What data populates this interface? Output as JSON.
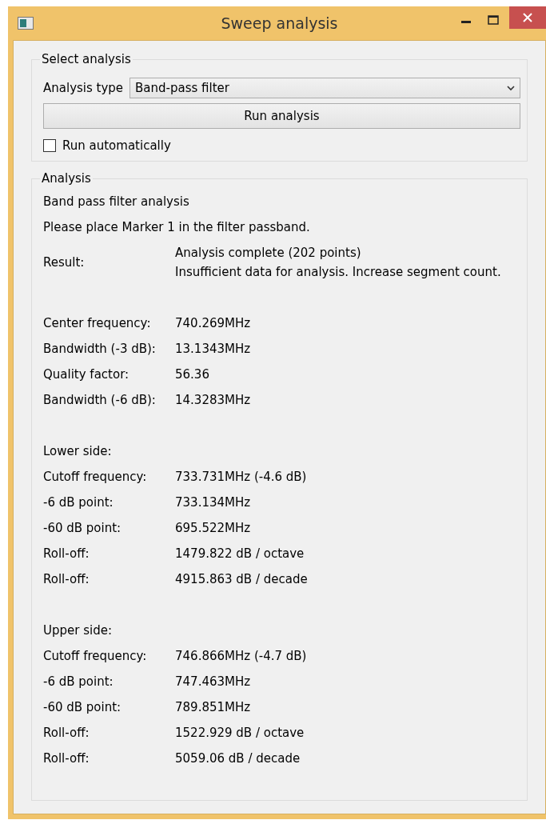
{
  "window": {
    "title": "Sweep analysis"
  },
  "select_analysis": {
    "title": "Select analysis",
    "analysis_type": {
      "label": "Analysis type",
      "value": "Band-pass filter"
    },
    "run_button": "Run analysis",
    "run_automatically": {
      "label": "Run automatically",
      "checked": false
    }
  },
  "analysis": {
    "title": "Analysis",
    "lines": [
      "Band pass filter analysis",
      "Please place Marker 1 in the filter passband."
    ],
    "result": {
      "label": "Result:",
      "value_lines": [
        "Analysis complete (202 points)",
        "Insufficient data for analysis. Increase segment count."
      ]
    },
    "groups": [
      {
        "rows": [
          {
            "label": "Center frequency:",
            "value": "740.269MHz"
          },
          {
            "label": "Bandwidth (-3 dB):",
            "value": "13.1343MHz"
          },
          {
            "label": "Quality factor:",
            "value": "56.36"
          },
          {
            "label": "Bandwidth (-6 dB):",
            "value": "14.3283MHz"
          }
        ]
      },
      {
        "heading": "Lower side:",
        "rows": [
          {
            "label": "Cutoff frequency:",
            "value": "733.731MHz (-4.6 dB)"
          },
          {
            "label": "-6 dB point:",
            "value": "733.134MHz"
          },
          {
            "label": "-60 dB point:",
            "value": "695.522MHz"
          },
          {
            "label": "Roll-off:",
            "value": "1479.822 dB / octave"
          },
          {
            "label": "Roll-off:",
            "value": "4915.863 dB / decade"
          }
        ]
      },
      {
        "heading": "Upper side:",
        "rows": [
          {
            "label": "Cutoff frequency:",
            "value": "746.866MHz (-4.7 dB)"
          },
          {
            "label": "-6 dB point:",
            "value": "747.463MHz"
          },
          {
            "label": "-60 dB point:",
            "value": "789.851MHz"
          },
          {
            "label": "Roll-off:",
            "value": "1522.929 dB / octave"
          },
          {
            "label": "Roll-off:",
            "value": "5059.06 dB / decade"
          }
        ]
      }
    ]
  }
}
